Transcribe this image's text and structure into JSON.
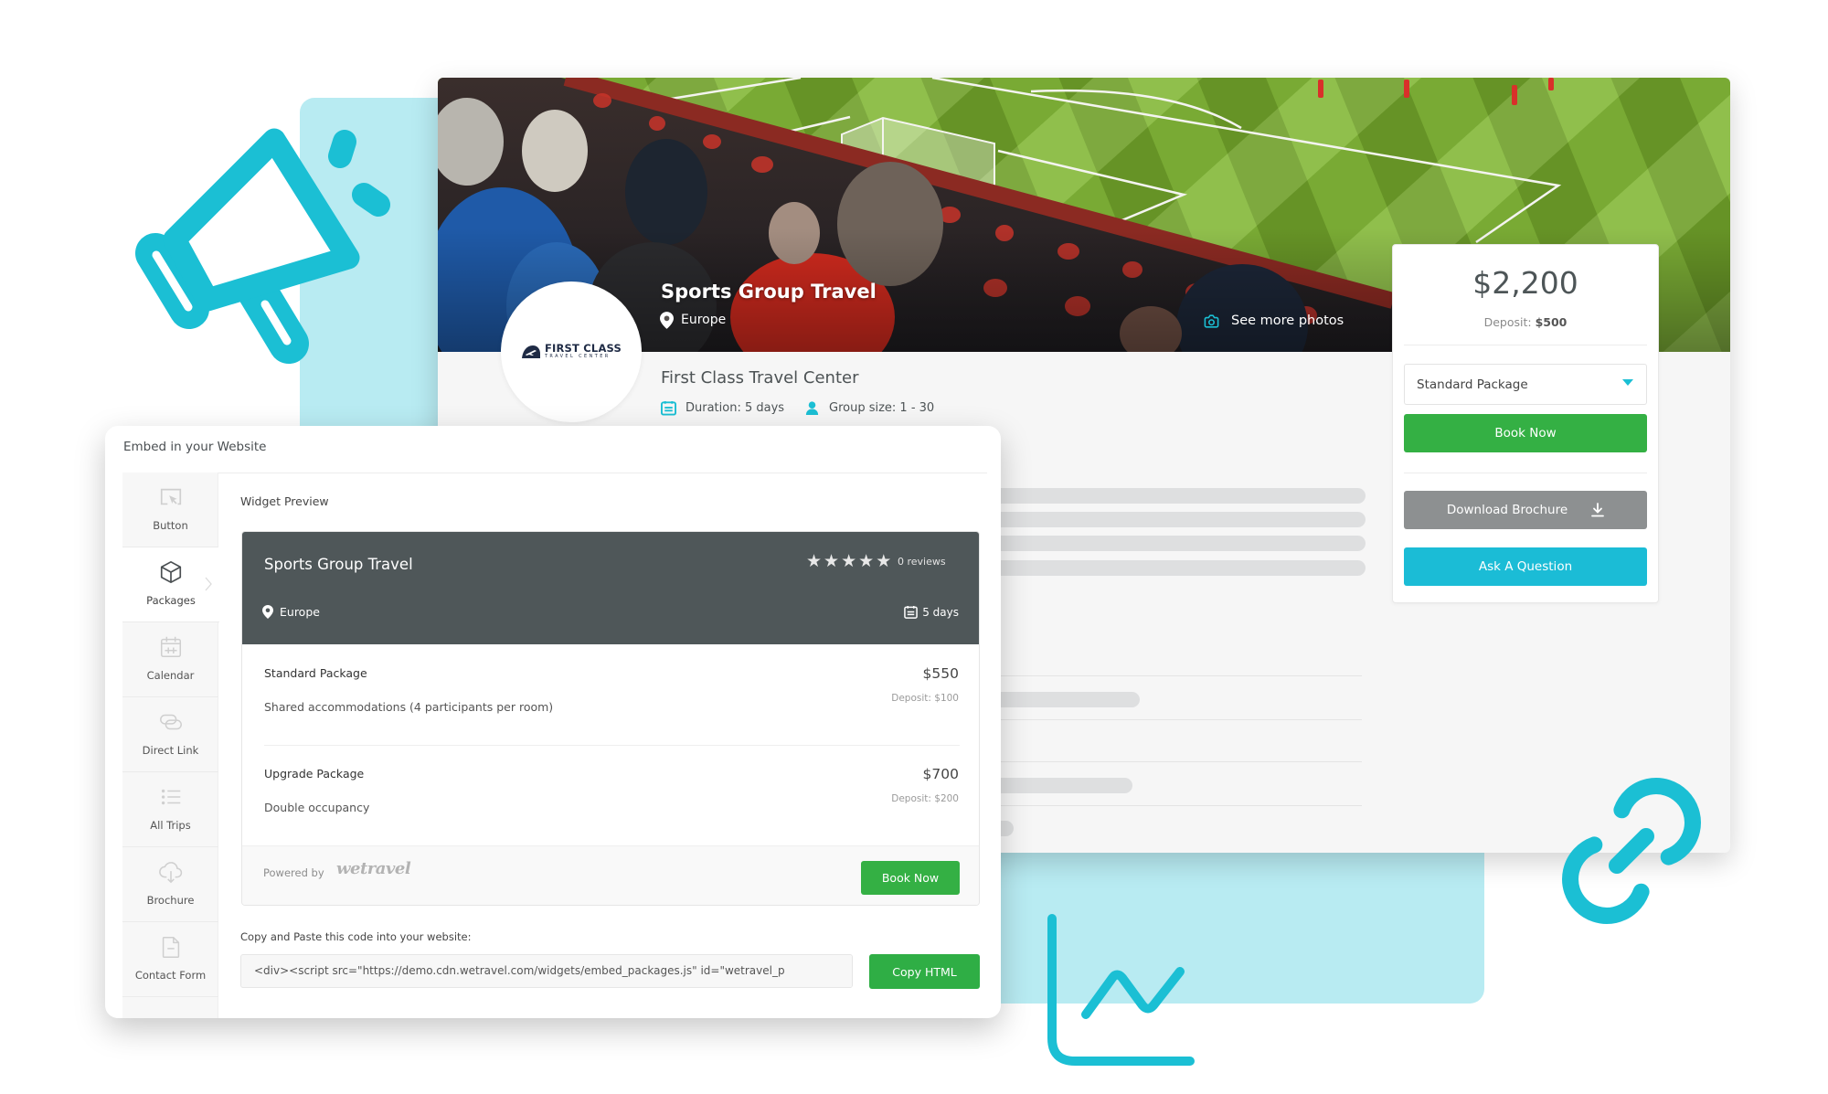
{
  "colors": {
    "accent_cyan": "#1bbfd4",
    "light_cyan": "#b8ebf2",
    "book_green": "#34b044",
    "brochure_grey": "#8d9091",
    "ask_cyan": "#1bbcd6",
    "widget_header": "#4f5759"
  },
  "hero": {
    "title": "Sports Group Travel",
    "location": "Europe",
    "see_more_photos": "See more photos"
  },
  "organizer": {
    "logo_line1": "FIRST CLASS",
    "logo_line2": "TRAVEL CENTER",
    "name": "First Class Travel Center",
    "duration": "Duration: 5 days",
    "group_size": "Group size: 1 - 30"
  },
  "price_card": {
    "price": "$2,200",
    "deposit_label": "Deposit: ",
    "deposit_value": "$500",
    "package_select": "Standard Package",
    "book_now": "Book Now",
    "download_brochure": "Download Brochure",
    "ask_question": "Ask A Question"
  },
  "embed": {
    "title": "Embed in your Website",
    "nav": [
      {
        "label": "Button",
        "icon": "cursor-button-icon",
        "active": false
      },
      {
        "label": "Packages",
        "icon": "cube-icon",
        "active": true
      },
      {
        "label": "Calendar",
        "icon": "calendar-icon",
        "active": false
      },
      {
        "label": "Direct Link",
        "icon": "chain-link-icon",
        "active": false
      },
      {
        "label": "All Trips",
        "icon": "list-icon",
        "active": false
      },
      {
        "label": "Brochure",
        "icon": "cloud-download-icon",
        "active": false
      },
      {
        "label": "Contact Form",
        "icon": "document-icon",
        "active": false
      }
    ],
    "preview_label": "Widget Preview",
    "widget": {
      "trip_title": "Sports Group Travel",
      "stars_shown": 5,
      "reviews": "0 reviews",
      "location": "Europe",
      "duration": "5 days",
      "packages": [
        {
          "name": "Standard Package",
          "description": "Shared accommodations (4 participants per room)",
          "price": "$550",
          "deposit": "Deposit: $100"
        },
        {
          "name": "Upgrade Package",
          "description": "Double occupancy",
          "price": "$700",
          "deposit": "Deposit: $200"
        }
      ],
      "powered_by": "Powered by",
      "brand": "wetravel",
      "book_now": "Book Now"
    },
    "copy_label": "Copy and Paste this code into your website:",
    "code": "<div><script src=\"https://demo.cdn.wetravel.com/widgets/embed_packages.js\" id=\"wetravel_p",
    "copy_button": "Copy HTML"
  }
}
